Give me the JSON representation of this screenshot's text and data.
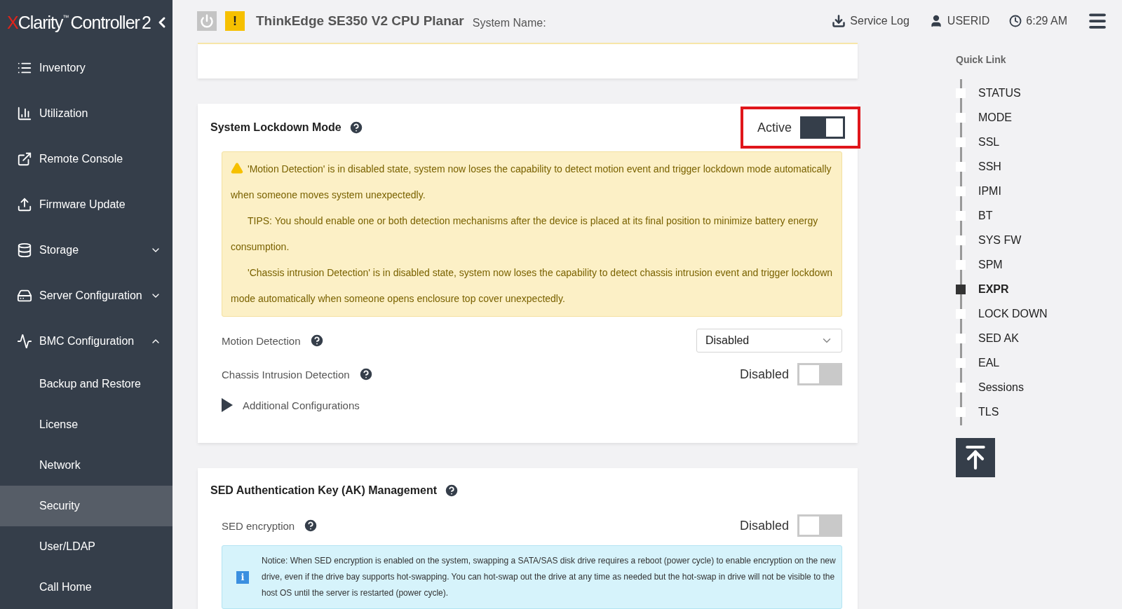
{
  "logo": {
    "prefix": "X",
    "name": "Clarity",
    "trademark": "™",
    "product": "Controller",
    "version": "2"
  },
  "sidebar": {
    "items": [
      {
        "label": "Inventory",
        "kind": "top"
      },
      {
        "label": "Utilization",
        "kind": "top"
      },
      {
        "label": "Remote Console",
        "kind": "top"
      },
      {
        "label": "Firmware Update",
        "kind": "top"
      },
      {
        "label": "Storage",
        "kind": "group",
        "expanded": false
      },
      {
        "label": "Server Configuration",
        "kind": "group",
        "expanded": false
      },
      {
        "label": "BMC Configuration",
        "kind": "group",
        "expanded": true
      },
      {
        "label": "Backup and Restore",
        "kind": "sub",
        "selected": false
      },
      {
        "label": "License",
        "kind": "sub",
        "selected": false
      },
      {
        "label": "Network",
        "kind": "sub",
        "selected": false
      },
      {
        "label": "Security",
        "kind": "sub",
        "selected": true
      },
      {
        "label": "User/LDAP",
        "kind": "sub",
        "selected": false
      },
      {
        "label": "Call Home",
        "kind": "sub",
        "selected": false
      }
    ]
  },
  "header": {
    "warning_badge": "!",
    "title": "ThinkEdge SE350 V2 CPU Planar",
    "system_name_label": "System Name:",
    "service_log": "Service Log",
    "user": "USERID",
    "time": "6:29 AM"
  },
  "lockdown": {
    "title": "System Lockdown Mode",
    "status": "Active",
    "on": true,
    "highlighted": true,
    "warnings": [
      "'Motion Detection' is in disabled state, system now loses the capability to detect motion event and trigger lockdown mode automatically when someone moves system unexpectedly.",
      "TIPS: You should enable one or both detection mechanisms after the device is placed at its final position to minimize battery energy consumption.",
      "'Chassis intrusion Detection' is in disabled state, system now loses the capability to detect chassis intrusion event and trigger lockdown mode automatically when someone opens enclosure top cover unexpectedly."
    ],
    "motion_detection": {
      "label": "Motion Detection",
      "value": "Disabled"
    },
    "chassis_intrusion": {
      "label": "Chassis Intrusion Detection",
      "status": "Disabled",
      "on": false
    },
    "additional": {
      "label": "Additional Configurations",
      "expanded": false
    }
  },
  "sed": {
    "info_badge": "i",
    "title": "SED Authentication Key (AK) Management",
    "encryption_label": "SED encryption",
    "status": "Disabled",
    "on": false,
    "notice": "Notice: When SED encryption is enabled on the system, swapping a SATA/SAS disk drive requires a reboot (power cycle) to enable encryption on the new drive, even if the drive bay supports hot-swapping. You can hot-swap out the drive at any time as needed but the hot-swap in drive will not be visible to the host OS until the server is restarted (power cycle)."
  },
  "quick_link": {
    "title": "Quick Link",
    "items": [
      {
        "label": "STATUS",
        "selected": false
      },
      {
        "label": "MODE",
        "selected": false
      },
      {
        "label": "SSL",
        "selected": false
      },
      {
        "label": "SSH",
        "selected": false
      },
      {
        "label": "IPMI",
        "selected": false
      },
      {
        "label": "BT",
        "selected": false
      },
      {
        "label": "SYS FW",
        "selected": false
      },
      {
        "label": "SPM",
        "selected": false
      },
      {
        "label": "EXPR",
        "selected": true
      },
      {
        "label": "LOCK DOWN",
        "selected": false
      },
      {
        "label": "SED AK",
        "selected": false
      },
      {
        "label": "EAL",
        "selected": false
      },
      {
        "label": "Sessions",
        "selected": false
      },
      {
        "label": "TLS",
        "selected": false
      }
    ]
  }
}
